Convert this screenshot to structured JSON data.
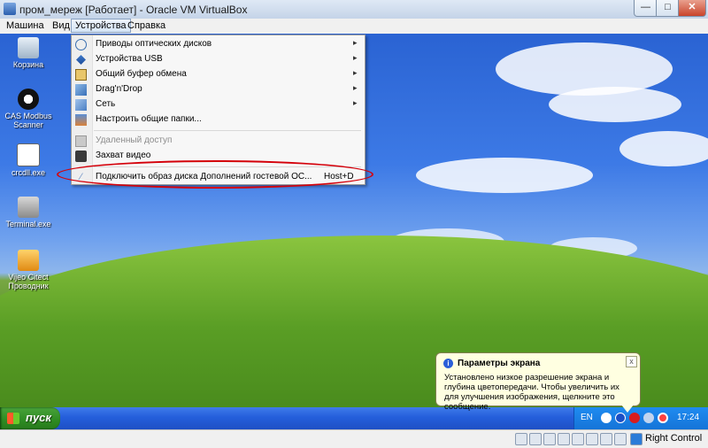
{
  "window": {
    "title": "пром_мереж [Работает] - Oracle VM VirtualBox",
    "min_glyph": "—",
    "max_glyph": "□",
    "close_glyph": "✕"
  },
  "menubar": {
    "items": [
      "Машина",
      "Вид",
      "Устройства",
      "Справка"
    ]
  },
  "devices_menu": {
    "items": [
      {
        "label": "Приводы оптических дисков",
        "icon": "optical-disk-icon",
        "submenu": true
      },
      {
        "label": "Устройства USB",
        "icon": "usb-icon",
        "submenu": true
      },
      {
        "label": "Общий буфер обмена",
        "icon": "clipboard-icon",
        "submenu": true
      },
      {
        "label": "Drag'n'Drop",
        "icon": "drag-drop-icon",
        "submenu": true
      },
      {
        "label": "Сеть",
        "icon": "network-icon",
        "submenu": true
      },
      {
        "label": "Настроить общие папки...",
        "icon": "shared-folders-icon",
        "submenu": false
      },
      {
        "label": "Удаленный доступ",
        "icon": "remote-display-icon",
        "disabled": true
      },
      {
        "label": "Захват видео",
        "icon": "video-capture-icon"
      },
      {
        "label": "Подключить образ диска Дополнений гостевой ОС...",
        "icon": "guest-additions-icon",
        "shortcut": "Host+D"
      }
    ],
    "arrow": "▸"
  },
  "desktop_icons": [
    {
      "label": "Корзина",
      "icon": "recycle-bin-icon"
    },
    {
      "label": "CAS Modbus Scanner",
      "icon": "modbus-scanner-icon"
    },
    {
      "label": "crcdll.exe",
      "icon": "exe-file-icon"
    },
    {
      "label": "Terminal.exe",
      "icon": "terminal-icon"
    },
    {
      "label": "Vijeo Citect Проводник",
      "icon": "vijeo-citect-icon"
    }
  ],
  "balloon": {
    "title": "Параметры экрана",
    "text": "Установлено низкое разрешение экрана и глубина цветопередачи. Чтобы увеличить их для улучшения изображения, щелкните это сообщение.",
    "close": "x",
    "info_glyph": "i"
  },
  "taskbar": {
    "start_label": "пуск",
    "language": "EN",
    "clock": "17:24"
  },
  "statusbar": {
    "host_key": "Right Control"
  },
  "colors": {
    "highlight": "#d4000a",
    "taskbar": "#245edb",
    "start": "#2e8b22"
  }
}
